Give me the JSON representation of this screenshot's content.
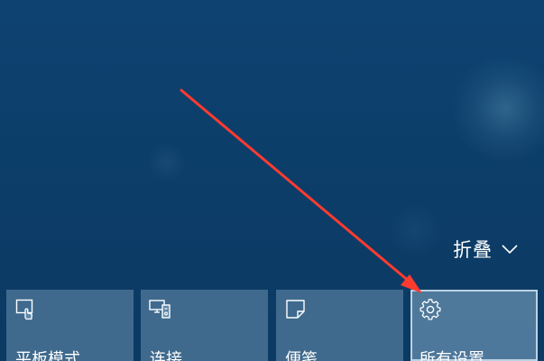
{
  "action_center": {
    "collapse": {
      "label": "折叠",
      "icon": "chevron-down-icon"
    },
    "tiles": [
      {
        "label": "平板模式",
        "icon": "tablet-mode-icon"
      },
      {
        "label": "连接",
        "icon": "connect-icon"
      },
      {
        "label": "便笺",
        "icon": "note-icon"
      },
      {
        "label": "所有设置",
        "icon": "gear-icon",
        "highlighted": true
      }
    ]
  },
  "annotation": {
    "arrow_color": "#ff3b30"
  },
  "colors": {
    "desktop_background": "#0d3f6b",
    "tile_background": "#6088a8",
    "text": "#ffffff"
  }
}
